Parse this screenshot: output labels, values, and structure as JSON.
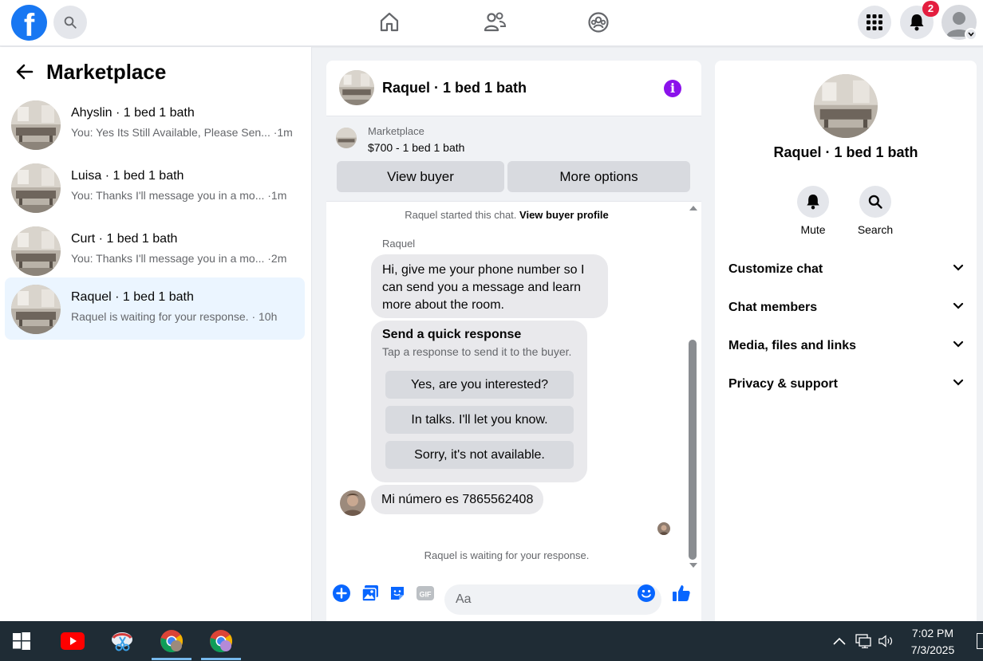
{
  "topbar": {
    "logo_letter": "f",
    "notification_count": "2",
    "accent": "#1877f2",
    "badge_color": "#e41e3f"
  },
  "sidebar": {
    "title": "Marketplace",
    "conversations": [
      {
        "name": "Ahyslin · 1 bed 1 bath",
        "snippet": "You: Yes Its Still Available, Please Sen... ·1m"
      },
      {
        "name": "Luisa · 1 bed 1 bath",
        "snippet": "You: Thanks I'll message you in a mo... ·1m"
      },
      {
        "name": "Curt · 1 bed 1 bath",
        "snippet": "You: Thanks I'll message you in a mo... ·2m"
      },
      {
        "name": "Raquel · 1 bed 1 bath",
        "snippet": "Raquel is waiting for your response. · 10h"
      }
    ],
    "active_color": "#ebf5ff"
  },
  "chat": {
    "title": "Raquel · 1 bed 1 bath",
    "info_icon": "i",
    "listing": {
      "label": "Marketplace",
      "price": "$700 - 1 bed 1 bath",
      "view_buyer": "View buyer",
      "more_options": "More options"
    },
    "system_start_text": "Raquel started this chat.",
    "system_start_link": "View buyer profile",
    "sender_name": "Raquel",
    "message_1": "Hi, give me your phone number so I can send you a message and learn more about the room.",
    "quick_response": {
      "title": "Send a quick response",
      "subtitle": "Tap a response to send it to the buyer.",
      "options": [
        "Yes, are you interested?",
        "In talks. I'll let you know.",
        "Sorry, it's not available."
      ]
    },
    "message_2": "Mi número es 7865562408",
    "waiting_text": "Raquel is waiting for your response.",
    "composer_placeholder": "Aa",
    "info_color": "#8b12eb"
  },
  "details": {
    "name": "Raquel · 1 bed 1 bath",
    "actions": [
      {
        "label": "Mute",
        "icon": "bell-icon"
      },
      {
        "label": "Search",
        "icon": "search-icon"
      }
    ],
    "sections": [
      "Customize chat",
      "Chat members",
      "Media, files and links",
      "Privacy & support"
    ]
  },
  "taskbar": {
    "time": "7:02 PM",
    "date": "7/3/2025"
  }
}
